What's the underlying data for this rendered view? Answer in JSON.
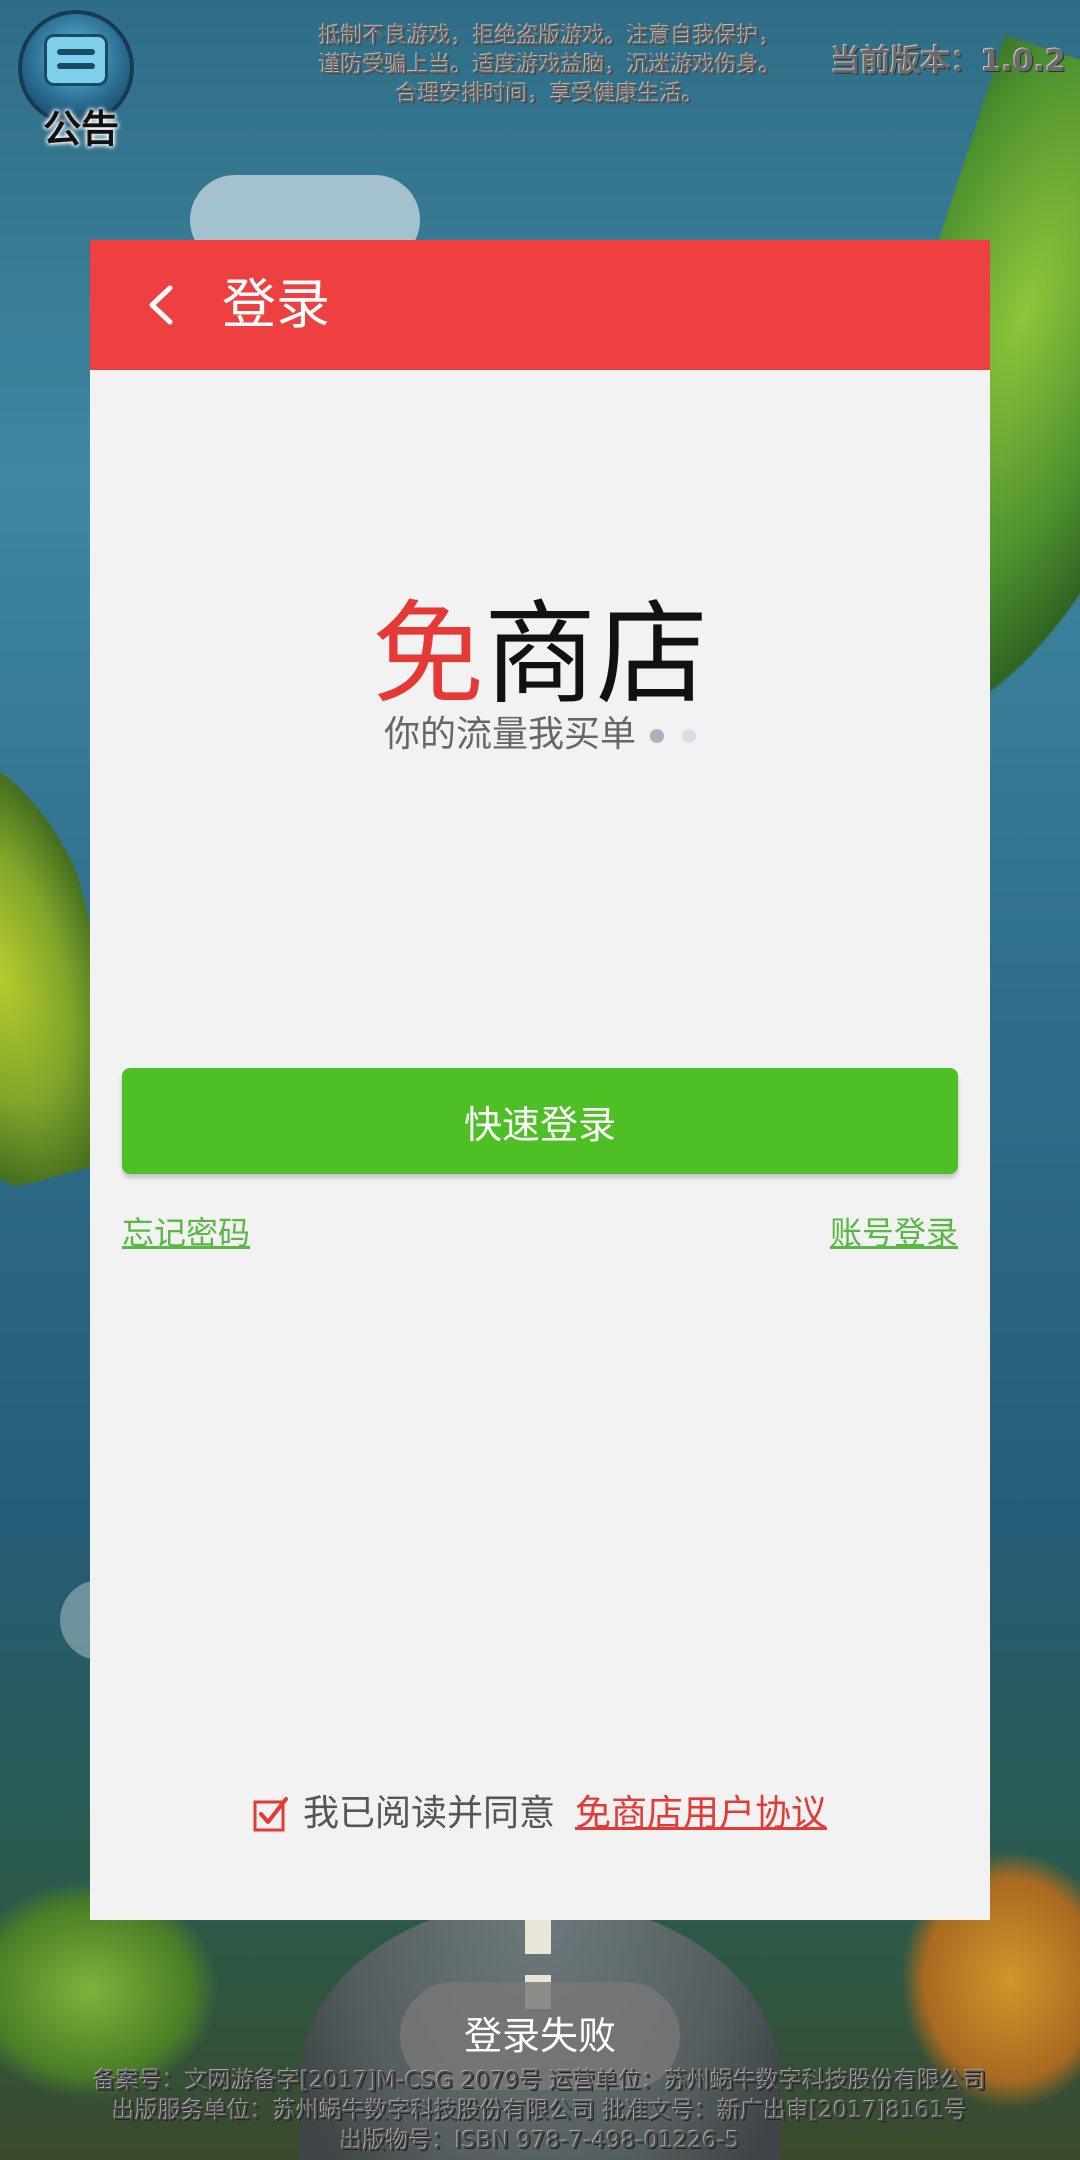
{
  "top_bar": {
    "notice_label": "公告",
    "health_tip_lines": [
      "抵制不良游戏，拒绝盗版游戏。注意自我保护，",
      "谨防受骗上当。适度游戏益脑，沉迷游戏伤身。",
      "合理安排时间，享受健康生活。"
    ],
    "version": "当前版本：1.0.2"
  },
  "dialog": {
    "title": "登录",
    "brand_red": "免",
    "brand_black": "商店",
    "slogan": "你的流量我买单",
    "quick_login_label": "快速登录",
    "forgot_password_label": "忘记密码",
    "account_login_label": "账号登录",
    "agree_text": "我已阅读并同意",
    "agreement_link": "免商店用户协议"
  },
  "toast": {
    "message": "登录失败"
  },
  "footer": {
    "lines": [
      "备案号：文网游备字[2017]M-CSG 2079号 运营单位：苏州蜗牛数字科技股份有限公司",
      "出版服务单位：苏州蜗牛数字科技股份有限公司 批准文号：新广出审[2017]8161号",
      "出版物号：ISBN 978-7-498-01226-5"
    ]
  },
  "colors": {
    "header_red": "#ee4040",
    "brand_red": "#e53935",
    "button_green": "#4fbf26",
    "link_green": "#59b843",
    "dialog_bg": "#f2f2f2"
  },
  "icons": {
    "notice": "notice-board-icon",
    "back": "chevron-left-icon",
    "checkbox": "checkbox-checked-icon"
  }
}
